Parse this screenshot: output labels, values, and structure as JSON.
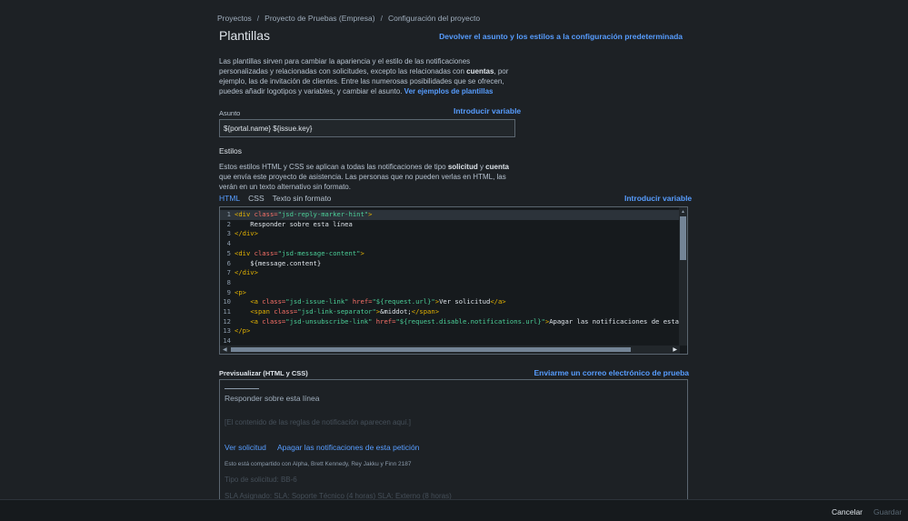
{
  "breadcrumb": {
    "items": [
      "Proyectos",
      "Proyecto de Pruebas (Empresa)",
      "Configuración del proyecto"
    ],
    "separator": "/"
  },
  "page": {
    "title": "Plantillas",
    "reset_link": "Devolver el asunto y los estilos a la configuración predeterminada"
  },
  "intro": {
    "part1": "Las plantillas sirven para cambiar la apariencia y el estilo de las notificaciones personalizadas y relacionadas con solicitudes, excepto las relacionadas con ",
    "bold": "cuentas",
    "part2": ", por ejemplo, las de invitación de clientes. Entre las numerosas posibilidades que se ofrecen, puedes añadir logotipos y variables, y cambiar el asunto. ",
    "link": "Ver ejemplos de plantillas"
  },
  "subject": {
    "label": "Asunto",
    "insert_variable": "Introducir variable",
    "value": "${portal.name} ${issue.key}"
  },
  "styles": {
    "label": "Estilos",
    "desc_part1": "Estos estilos HTML y CSS se aplican a todas las notificaciones de tipo ",
    "desc_bold1": "solicitud",
    "desc_part2": " y ",
    "desc_bold2": "cuenta",
    "desc_part3": " que envía este proyecto de asistencia. Las personas que no pueden verlas en HTML, las verán en un texto alternativo sin formato.",
    "tabs": [
      "HTML",
      "CSS",
      "Texto sin formato"
    ],
    "active_tab": "HTML",
    "insert_variable": "Introducir variable"
  },
  "editor": {
    "lines": [
      {
        "n": "1",
        "code": [
          [
            "tag",
            "<div "
          ],
          [
            "attr",
            "class="
          ],
          [
            "str",
            "\"jsd-reply-marker-hint\""
          ],
          [
            "tag",
            ">"
          ]
        ]
      },
      {
        "n": "2",
        "code": [
          [
            "text",
            "    Responder sobre esta línea"
          ]
        ]
      },
      {
        "n": "3",
        "code": [
          [
            "tag",
            "</div>"
          ]
        ]
      },
      {
        "n": "4",
        "code": []
      },
      {
        "n": "5",
        "code": [
          [
            "tag",
            "<div "
          ],
          [
            "attr",
            "class="
          ],
          [
            "str",
            "\"jsd-message-content\""
          ],
          [
            "tag",
            ">"
          ]
        ]
      },
      {
        "n": "6",
        "code": [
          [
            "text",
            "    ${message.content}"
          ]
        ]
      },
      {
        "n": "7",
        "code": [
          [
            "tag",
            "</div>"
          ]
        ]
      },
      {
        "n": "8",
        "code": []
      },
      {
        "n": "9",
        "code": [
          [
            "tag",
            "<p>"
          ]
        ]
      },
      {
        "n": "10",
        "code": [
          [
            "text",
            "    "
          ],
          [
            "tag",
            "<a "
          ],
          [
            "attr",
            "class="
          ],
          [
            "str",
            "\"jsd-issue-link\""
          ],
          [
            "attr",
            " href="
          ],
          [
            "str",
            "\"${request.url}\""
          ],
          [
            "tag",
            ">"
          ],
          [
            "text",
            "Ver solicitud"
          ],
          [
            "tag",
            "</a>"
          ]
        ]
      },
      {
        "n": "11",
        "code": [
          [
            "text",
            "    "
          ],
          [
            "tag",
            "<span "
          ],
          [
            "attr",
            "class="
          ],
          [
            "str",
            "\"jsd-link-separator\""
          ],
          [
            "tag",
            ">"
          ],
          [
            "text",
            "&middot;"
          ],
          [
            "tag",
            "</span>"
          ]
        ]
      },
      {
        "n": "12",
        "code": [
          [
            "text",
            "    "
          ],
          [
            "tag",
            "<a "
          ],
          [
            "attr",
            "class="
          ],
          [
            "str",
            "\"jsd-unsubscribe-link\""
          ],
          [
            "attr",
            " href="
          ],
          [
            "str",
            "\"${request.disable.notifications.url}\""
          ],
          [
            "tag",
            ">"
          ],
          [
            "text",
            "Apagar las notificaciones de esta pe"
          ]
        ]
      },
      {
        "n": "13",
        "code": [
          [
            "tag",
            "</p>"
          ]
        ]
      },
      {
        "n": "14",
        "code": []
      }
    ],
    "highlighted_line": 1
  },
  "preview": {
    "label": "Previsualizar (HTML y CSS)",
    "send_test": "Enviarme un correo electrónico de prueba",
    "reply_hint": "Responder sobre esta línea",
    "rules_placeholder": "[El contenido de las reglas de notificación aparecen aquí.]",
    "view_request": "Ver solicitud",
    "unsubscribe": "Apagar las notificaciones de esta petición",
    "shared_with": "Esto está compartido con Alpha, Brett Kennedy, Rey Jakku y Finn 2187",
    "request_type": "Tipo de solicitud: BB-6",
    "sla": "SLA Asignado: SLA: Soporte Técnico (4 horas) SLA: Externo (8 horas)"
  },
  "footer": {
    "cancel": "Cancelar",
    "save": "Guardar"
  },
  "colors": {
    "background": "#1d2125",
    "link": "#579dff",
    "tag": "#e2b203",
    "attr": "#f87168",
    "string": "#4bce97"
  }
}
